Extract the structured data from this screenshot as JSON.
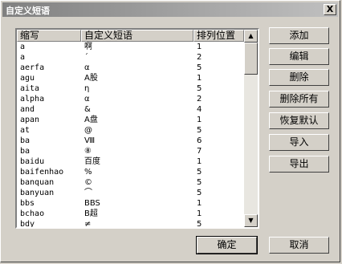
{
  "window": {
    "title": "自定义短语",
    "close_label": "X"
  },
  "columns": [
    "缩写",
    "自定义短语",
    "排列位置"
  ],
  "rows": [
    {
      "abbr": "a",
      "phrase": "啊",
      "pos": "1"
    },
    {
      "abbr": "a",
      "phrase": "ˊ",
      "pos": "2"
    },
    {
      "abbr": "aerfa",
      "phrase": "α",
      "pos": "5"
    },
    {
      "abbr": "agu",
      "phrase": "A股",
      "pos": "1"
    },
    {
      "abbr": "aita",
      "phrase": "η",
      "pos": "5"
    },
    {
      "abbr": "alpha",
      "phrase": "α",
      "pos": "2"
    },
    {
      "abbr": "and",
      "phrase": "&",
      "pos": "4"
    },
    {
      "abbr": "apan",
      "phrase": "A盘",
      "pos": "1"
    },
    {
      "abbr": "at",
      "phrase": "@",
      "pos": "5"
    },
    {
      "abbr": "ba",
      "phrase": "Ⅷ",
      "pos": "6"
    },
    {
      "abbr": "ba",
      "phrase": "⑧",
      "pos": "7"
    },
    {
      "abbr": "baidu",
      "phrase": "百度",
      "pos": "1"
    },
    {
      "abbr": "baifenhao",
      "phrase": "%",
      "pos": "5"
    },
    {
      "abbr": "banquan",
      "phrase": "©",
      "pos": "5"
    },
    {
      "abbr": "banyuan",
      "phrase": "⌒",
      "pos": "5"
    },
    {
      "abbr": "bbs",
      "phrase": "BBS",
      "pos": "1"
    },
    {
      "abbr": "bchao",
      "phrase": "B超",
      "pos": "1"
    },
    {
      "abbr": "bdy",
      "phrase": "≠",
      "pos": "5"
    }
  ],
  "buttons": {
    "add": "添加",
    "edit": "编辑",
    "delete": "删除",
    "delete_all": "删除所有",
    "restore_default": "恢复默认",
    "import": "导入",
    "export": "导出",
    "ok": "确定",
    "cancel": "取消"
  },
  "scrollbar": {
    "up_icon": "arrow-up-icon",
    "down_icon": "arrow-down-icon"
  }
}
